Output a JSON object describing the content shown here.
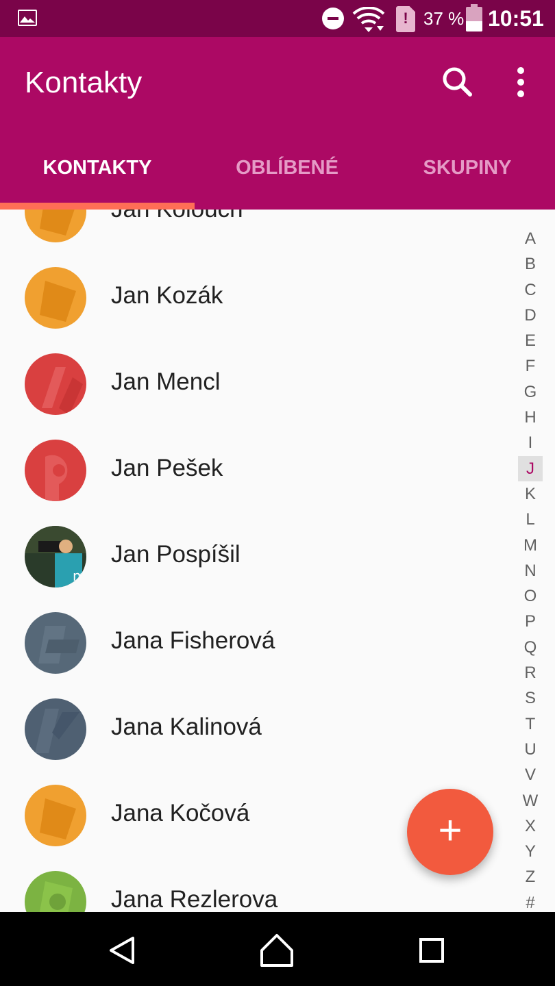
{
  "status_bar": {
    "battery_text": "37 %",
    "time": "10:51",
    "icons": [
      "image-icon",
      "do-not-disturb-icon",
      "wifi-icon",
      "sim-alert-icon",
      "battery-icon"
    ]
  },
  "app_bar": {
    "title": "Kontakty",
    "actions": [
      "search-icon",
      "more-vert-icon"
    ]
  },
  "tabs": [
    {
      "label": "KONTAKTY",
      "selected": true
    },
    {
      "label": "OBLÍBENÉ",
      "selected": false
    },
    {
      "label": "SKUPINY",
      "selected": false
    }
  ],
  "contacts": [
    {
      "name": "Jan Kolouch",
      "avatar_color": "#f0a030"
    },
    {
      "name": "Jan Kozák",
      "avatar_color": "#f0a030"
    },
    {
      "name": "Jan Mencl",
      "avatar_color": "#d94040"
    },
    {
      "name": "Jan Pešek",
      "avatar_color": "#d94040"
    },
    {
      "name": "Jan Pospíšil",
      "avatar_color": "#2a3b2a"
    },
    {
      "name": "Jana Fisherová",
      "avatar_color": "#566878"
    },
    {
      "name": "Jana Kalinová",
      "avatar_color": "#4f6072"
    },
    {
      "name": "Jana Kočová",
      "avatar_color": "#f0a030"
    },
    {
      "name": "Jana Rezlerova",
      "avatar_color": "#7cb342"
    }
  ],
  "index": {
    "letters": [
      "A",
      "B",
      "C",
      "D",
      "E",
      "F",
      "G",
      "H",
      "I",
      "J",
      "K",
      "L",
      "M",
      "N",
      "O",
      "P",
      "Q",
      "R",
      "S",
      "T",
      "U",
      "V",
      "W",
      "X",
      "Y",
      "Z",
      "#"
    ],
    "current": "J"
  },
  "fab": {
    "label": "+",
    "icon": "add-icon"
  },
  "nav_bar": {
    "buttons": [
      "back-icon",
      "home-icon",
      "recent-apps-icon"
    ]
  },
  "colors": {
    "status_bar": "#7a0449",
    "app_bar": "#ac0964",
    "tab_indicator": "#ff6e56",
    "fab": "#f25a3e",
    "index_current": "#ac0964"
  }
}
